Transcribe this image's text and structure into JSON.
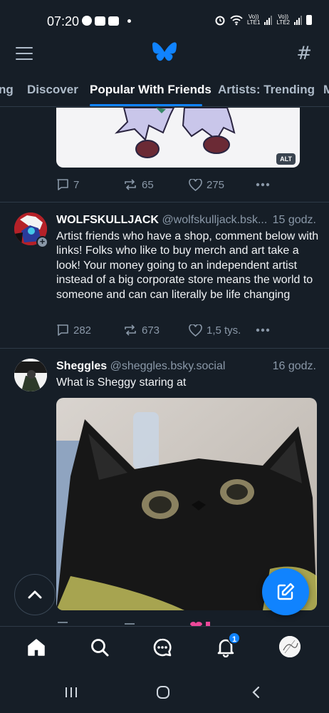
{
  "status_bar": {
    "time": "07:20",
    "sim1_label": "Vo))\nLTE1",
    "sim2_label": "Vo))\nLTE2"
  },
  "top_bar": {
    "logo_icon": "butterfly-logo-icon",
    "menu_icon": "hamburger-menu-icon",
    "feeds_icon": "hash-icon",
    "feeds_glyph": "#"
  },
  "tabs": [
    "ng",
    "Discover",
    "Popular With Friends",
    "Artists: Trending",
    "M"
  ],
  "active_tab": "Popular With Friends",
  "previous_post": {
    "alt_badge": "ALT",
    "replies": "7",
    "reposts": "65",
    "likes": "275"
  },
  "posts": [
    {
      "author": "WOLFSKULLJACK",
      "handle": "@wolfskulljack.bsk...",
      "time": "15 godz.",
      "text": "Artist friends who have a shop, comment below with links! Folks who like to buy merch and art take a look! Your money going to an independent artist instead of a big corporate store means the world to someone and can can literally be life changing",
      "replies": "282",
      "reposts": "673",
      "likes": "1,5 tys."
    },
    {
      "author": "Sheggles",
      "handle": "@sheggles.bsky.social",
      "time": "16 godz.",
      "text": "What is Sheggy staring at"
    }
  ],
  "bottom_nav": {
    "notification_count": "1"
  },
  "colors": {
    "background": "#161e27",
    "accent": "#1083fe",
    "muted": "#8a98a8"
  }
}
